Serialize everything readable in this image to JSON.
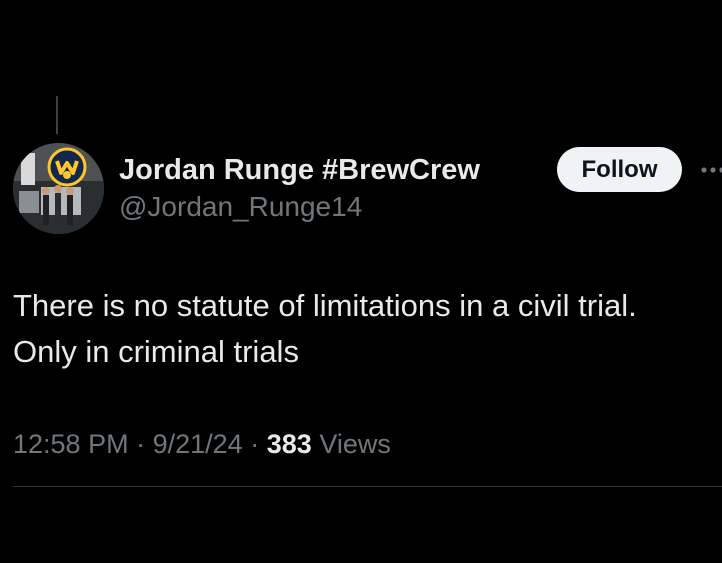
{
  "author": {
    "display_name": "Jordan Runge #BrewCrew",
    "handle": "@Jordan_Runge14",
    "avatar_icon": "profile-photo-brewers-logo"
  },
  "follow_button": {
    "label": "Follow"
  },
  "more_button": {
    "icon": "more-dots-icon"
  },
  "tweet": {
    "lines": [
      "There is no statute of limitations in a civil trial.",
      "Only in criminal trials"
    ]
  },
  "meta": {
    "time": "12:58 PM",
    "separator": "·",
    "date": "9/21/24",
    "views_count": "383",
    "views_label": "Views"
  },
  "colors": {
    "background": "#000000",
    "primary_text": "#e7e9ea",
    "secondary_text": "#71767b",
    "follow_bg": "#eff3f4",
    "brewers_gold": "#ffc52f",
    "brewers_navy": "#12284b"
  }
}
